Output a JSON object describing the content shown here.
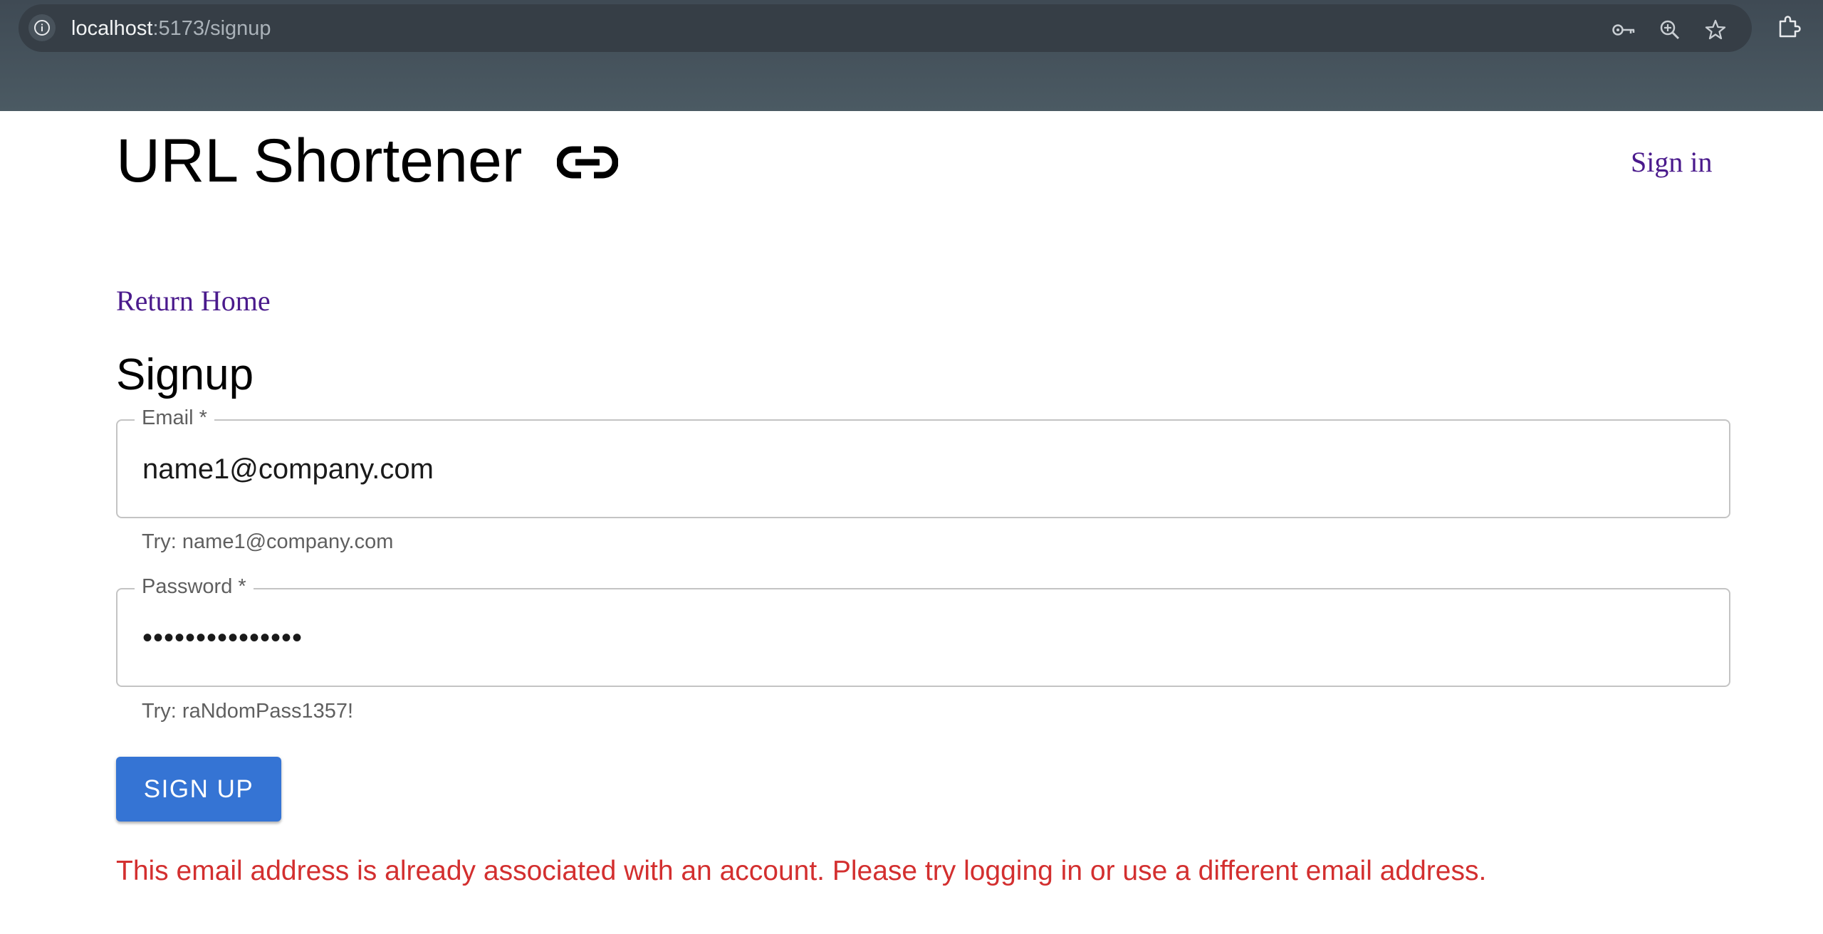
{
  "browser": {
    "url_host": "localhost",
    "url_path": ":5173/signup",
    "icons": [
      "info-icon",
      "key-icon",
      "zoom-icon",
      "star-icon",
      "extensions-icon"
    ]
  },
  "header": {
    "title": "URL Shortener",
    "title_icon": "link-icon",
    "signin_label": "Sign in"
  },
  "nav": {
    "return_home_label": "Return Home"
  },
  "form": {
    "heading": "Signup",
    "email": {
      "label": "Email *",
      "value": "name1@company.com",
      "helper": "Try: name1@company.com"
    },
    "password": {
      "label": "Password *",
      "value": "•••••••••••••••",
      "helper": "Try: raNdomPass1357!"
    },
    "submit_label": "SIGN UP",
    "error_message": "This email address is already associated with an account. Please try logging in or use a different email address."
  },
  "colors": {
    "link": "#4a1a8c",
    "button": "#3574d4",
    "error": "#d32f2f"
  }
}
